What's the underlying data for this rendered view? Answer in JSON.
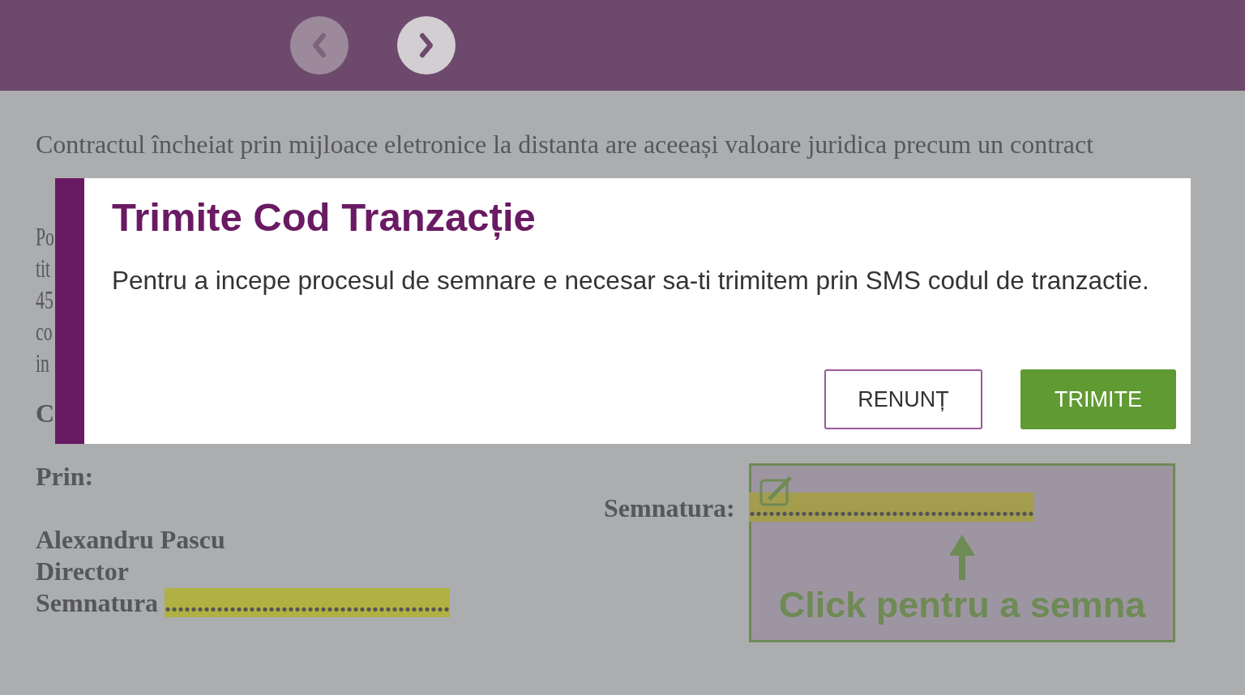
{
  "header": {
    "nav_buttons": [
      {
        "kind": "prev",
        "disabled": true
      },
      {
        "kind": "next",
        "disabled": false
      }
    ]
  },
  "document": {
    "intro_lines": [
      "Contractul încheiat prin mijloace eletronice la distanta are aceeași valoare juridica precum un contract"
    ],
    "paragraph_fragments": [
      "Po",
      "tit",
      "45",
      "co",
      "in"
    ],
    "company_lines": [
      "C",
      "Prin:"
    ],
    "signer_lines": [
      "Alexandru Pascu",
      "Director"
    ],
    "left_signature": {
      "label": "Semnatura",
      "dots": "............................................"
    },
    "right_signature": {
      "label": "Semnatura:",
      "dots": "............................................"
    },
    "sign_area": {
      "hint": "Click pentru a semna"
    }
  },
  "modal": {
    "title": "Trimite Cod Tranzacție",
    "message": "Pentru a incepe procesul de semnare e necesar sa-ti trimitem prin SMS codul de tranzactie.",
    "buttons": [
      {
        "label": "RENUNȚ",
        "kind": "secondary"
      },
      {
        "label": "TRIMITE",
        "kind": "primary"
      }
    ]
  }
}
